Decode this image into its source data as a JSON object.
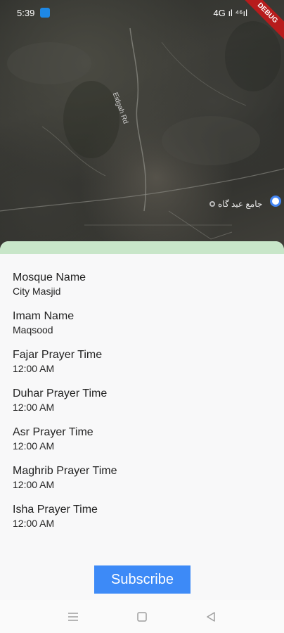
{
  "status_bar": {
    "time": "5:39",
    "right_text": "4G ıl ⁴⁶ıl"
  },
  "debug_banner": {
    "label": "DEBUG"
  },
  "map": {
    "place_label": "جامع عید گاه",
    "road_label": "Eidgah Rd",
    "colors": {
      "terrain": "#3b3b36",
      "road": "#9a9a92"
    }
  },
  "details": {
    "mosque_name": {
      "label": "Mosque Name",
      "value": "City Masjid"
    },
    "imam_name": {
      "label": "Imam Name",
      "value": "Maqsood"
    },
    "prayers": [
      {
        "label": "Fajar Prayer Time",
        "value": "12:00 AM"
      },
      {
        "label": "Duhar Prayer Time",
        "value": "12:00 AM"
      },
      {
        "label": "Asr Prayer Time",
        "value": "12:00 AM"
      },
      {
        "label": "Maghrib Prayer Time",
        "value": "12:00 AM"
      },
      {
        "label": "Isha Prayer Time",
        "value": "12:00 AM"
      }
    ]
  },
  "actions": {
    "subscribe_label": "Subscribe"
  },
  "nav": {
    "icons": [
      "menu-icon",
      "home-square-icon",
      "back-triangle-icon"
    ]
  },
  "colors": {
    "accent": "#3d8af7",
    "sheet_header": "#c8e6c9",
    "debug": "#b71c1c"
  }
}
